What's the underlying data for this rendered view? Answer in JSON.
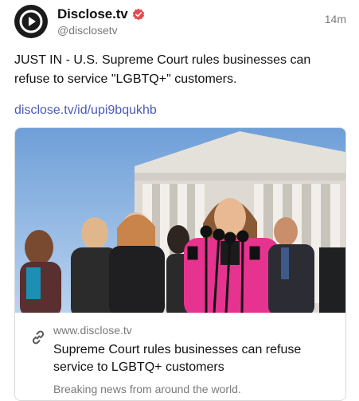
{
  "post": {
    "author": {
      "display_name": "Disclose.tv",
      "handle": "@disclosetv",
      "avatar_icon": "play-logo-icon",
      "verified_icon": "verified-badge-icon",
      "verified_color": "#e5484d"
    },
    "time": "14m",
    "text": "JUST IN - U.S. Supreme Court rules businesses can refuse to service \"LGBTQ+\" customers.",
    "link_text": "disclose.tv/id/upi9bqukhb",
    "link_color": "#4b5bb5"
  },
  "card": {
    "image_icon": "supreme-court-press-photo",
    "link_icon": "link-icon",
    "domain": "www.disclose.tv",
    "title": "Supreme Court rules businesses can refuse service to LGBTQ+ customers",
    "description": "Breaking news from around the world."
  }
}
